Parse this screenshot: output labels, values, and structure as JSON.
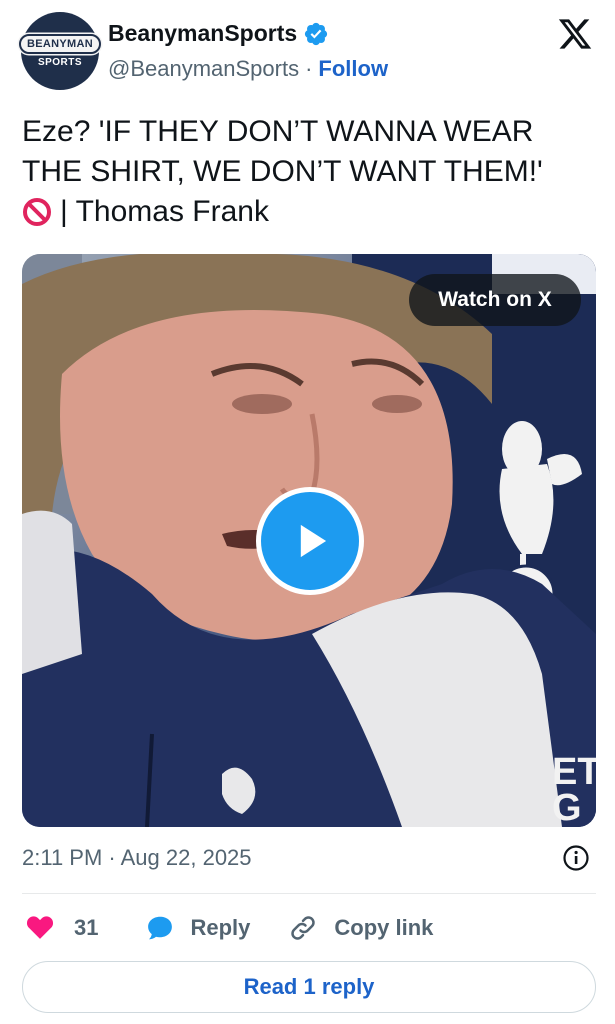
{
  "header": {
    "avatar_text": "BEANYMAN",
    "avatar_subtext": "SPORTS",
    "display_name": "BeanymanSports",
    "handle": "@BeanymanSports",
    "separator": "·",
    "follow_label": "Follow"
  },
  "tweet": {
    "line1": "Eze? 'IF THEY DON’T WANNA WEAR",
    "line2": "THE SHIRT, WE DON’T WANT THEM!'",
    "line3": "| Thomas Frank"
  },
  "video": {
    "watch_label": "Watch on X",
    "backdrop_text": "ET\nG"
  },
  "meta": {
    "timestamp": "2:11 PM · Aug 22, 2025"
  },
  "actions": {
    "like_count": "31",
    "reply_label": "Reply",
    "copy_label": "Copy link"
  },
  "footer": {
    "read_reply_label": "Read 1 reply"
  },
  "colors": {
    "accent_blue": "#1d63c9",
    "like_pink": "#f91880",
    "play_blue": "#1d9bf0",
    "secondary_text": "#536471"
  },
  "icons": [
    "verified-badge-icon",
    "x-logo-icon",
    "no-entry-icon",
    "play-icon",
    "info-icon",
    "heart-icon",
    "reply-bubble-icon",
    "link-icon"
  ]
}
